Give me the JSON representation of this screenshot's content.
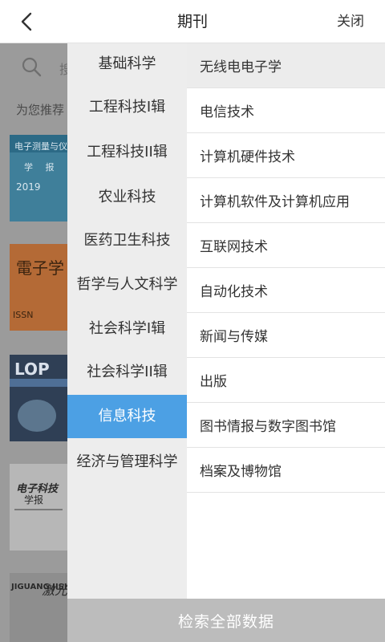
{
  "header": {
    "title": "期刊",
    "close_label": "关闭",
    "back_icon": "chevron-left-icon"
  },
  "background": {
    "search_placeholder": "搜",
    "recommend_title": "为您推荐",
    "covers": [
      {
        "line1": "电子测量与仪",
        "line2": "学 报",
        "line3": "2019"
      },
      {
        "line1": "電子学",
        "line2": "ISSN"
      },
      {
        "line1": "LOP"
      },
      {
        "line1": "电子科技",
        "line2": "学报"
      },
      {
        "line1": "JIGUANG JISHU",
        "line2": "激光"
      }
    ]
  },
  "categories": [
    {
      "label": "基础科学",
      "active": false
    },
    {
      "label": "工程科技I辑",
      "active": false
    },
    {
      "label": "工程科技II辑",
      "active": false
    },
    {
      "label": "农业科技",
      "active": false
    },
    {
      "label": "医药卫生科技",
      "active": false
    },
    {
      "label": "哲学与人文科学",
      "active": false
    },
    {
      "label": "社会科学I辑",
      "active": false
    },
    {
      "label": "社会科学II辑",
      "active": false
    },
    {
      "label": "信息科技",
      "active": true
    },
    {
      "label": "经济与管理科学",
      "active": false
    }
  ],
  "subcategories": [
    {
      "label": "无线电电子学"
    },
    {
      "label": "电信技术"
    },
    {
      "label": "计算机硬件技术"
    },
    {
      "label": "计算机软件及计算机应用"
    },
    {
      "label": "互联网技术"
    },
    {
      "label": "自动化技术"
    },
    {
      "label": "新闻与传媒"
    },
    {
      "label": "出版"
    },
    {
      "label": "图书情报与数字图书馆"
    },
    {
      "label": "档案及博物馆"
    }
  ],
  "bottom_button": {
    "label": "检索全部数据"
  },
  "colors": {
    "accent": "#4ca0e4",
    "left_column_bg": "#ededed",
    "overlay_gray": "#9b9b9b",
    "bottom_button_bg": "#bcbcbc"
  }
}
